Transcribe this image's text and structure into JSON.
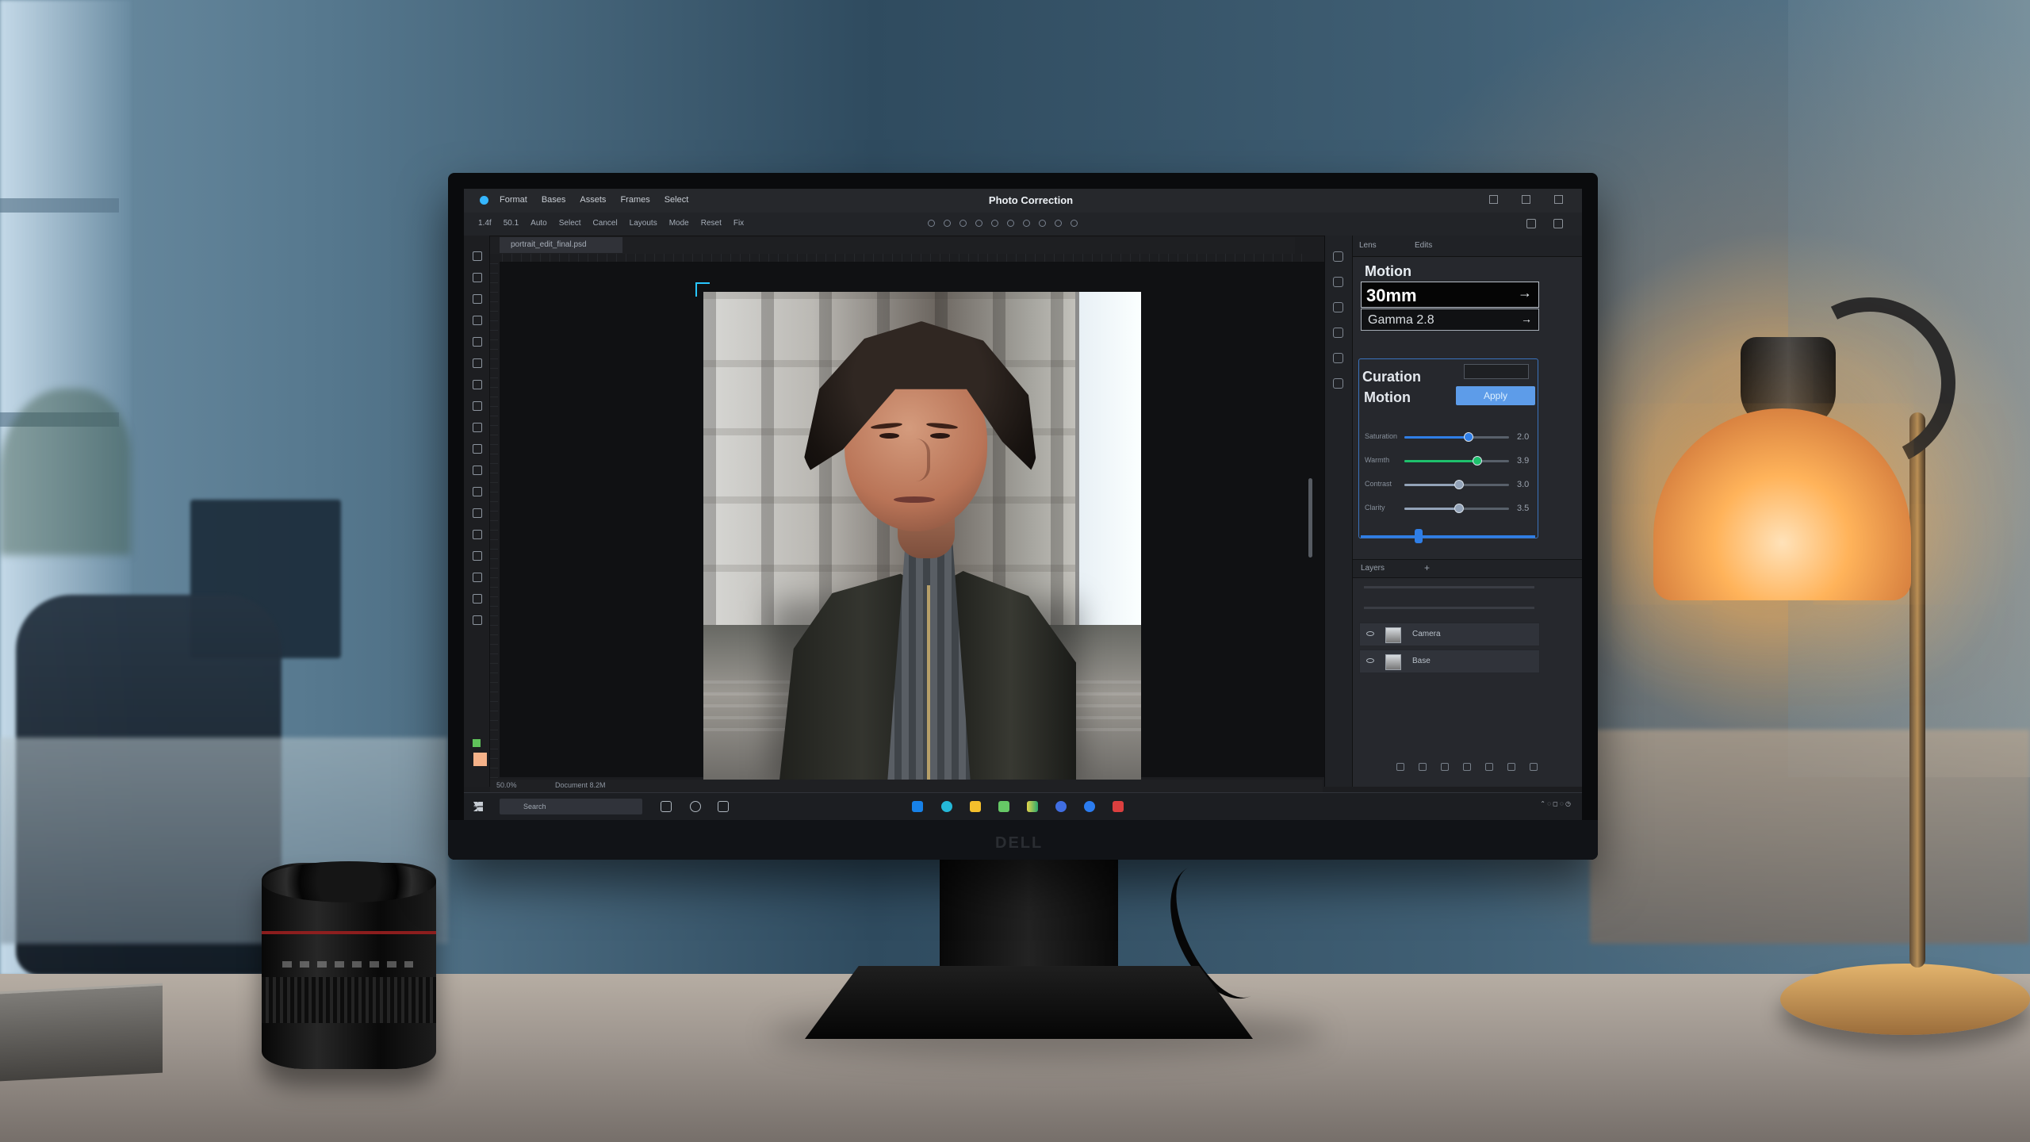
{
  "app": {
    "title": "Photo Correction",
    "menu": [
      "Format",
      "Bases",
      "Assets",
      "Frames",
      "Select"
    ]
  },
  "toolbar": {
    "options": [
      "1.4f",
      "50.1",
      "Auto",
      "Select",
      "Cancel",
      "Layouts",
      "Mode",
      "Reset",
      "Fix"
    ]
  },
  "document": {
    "tab_label": "portrait_edit_final.psd"
  },
  "panel": {
    "tabs": [
      "Lens",
      "Edits"
    ],
    "heading": "Motion",
    "focal_length": "30mm",
    "aperture": "Gamma 2.8",
    "correction_label": "Curation",
    "motion_label": "Motion",
    "button_label": "Apply",
    "sliders": [
      {
        "label": "Saturation",
        "value": "2.0",
        "level": 0.61,
        "color": "#2f7ee6"
      },
      {
        "label": "Warmth",
        "value": "3.9",
        "level": 0.7,
        "color": "#1ec06c"
      },
      {
        "label": "Contrast",
        "value": "3.0",
        "level": 0.52,
        "color": "#93a3b8"
      },
      {
        "label": "Clarity",
        "value": "3.5",
        "level": 0.52,
        "color": "#93a3b8"
      }
    ],
    "layers_title": "Layers",
    "layers": [
      "Camera",
      "Base"
    ]
  },
  "status": {
    "left": "50.0%",
    "center": "Document 8.2M"
  },
  "taskbar": {
    "search": "Search"
  },
  "colors": {
    "accent": "#2f7ee6",
    "selection": "#28c6ff",
    "swatch": "#f5b289"
  },
  "icons": {
    "windows": "windows-start-icon",
    "lamp": "desk-lamp-icon",
    "camera_lens": "camera-lens-icon"
  }
}
